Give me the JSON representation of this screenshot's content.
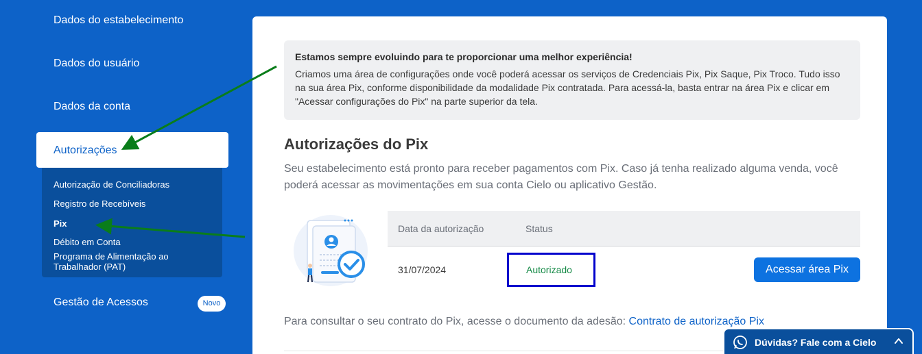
{
  "sidebar": {
    "items": [
      {
        "label": "Dados do estabelecimento"
      },
      {
        "label": "Dados do usuário"
      },
      {
        "label": "Dados da conta"
      }
    ],
    "active": {
      "label": "Autorizações"
    },
    "subitems": [
      {
        "label": "Autorização de Conciliadoras"
      },
      {
        "label": "Registro de Recebíveis"
      },
      {
        "label": "Pix"
      },
      {
        "label": "Débito em Conta"
      },
      {
        "label": "Programa de Alimentação ao Trabalhador (PAT)"
      }
    ],
    "gestao": {
      "label": "Gestão de Acessos",
      "badge": "Novo"
    }
  },
  "info_box": {
    "title": "Estamos sempre evoluindo para te proporcionar uma melhor experiência!",
    "body": "Criamos uma área de configurações onde você poderá acessar os serviços de Credenciais Pix, Pix Saque, Pix Troco. Tudo isso na sua área Pix, conforme disponibilidade da modalidade Pix contratada. Para acessá-la, basta entrar na área Pix e clicar em \"Acessar configurações do Pix\" na parte superior da tela."
  },
  "section": {
    "title": "Autorizações do Pix",
    "description": "Seu estabelecimento está pronto para receber pagamentos com Pix. Caso já tenha realizado alguma venda, você poderá acessar as movimentações em sua conta Cielo ou aplicativo Gestão."
  },
  "table": {
    "headers": [
      "Data da autorização",
      "Status"
    ],
    "rows": [
      {
        "date": "31/07/2024",
        "status": "Autorizado",
        "action": "Acessar área Pix"
      }
    ]
  },
  "contract": {
    "text": "Para consultar o seu contrato do Pix, acesse o documento da adesão: ",
    "link": "Contrato de autorização Pix"
  },
  "chat": {
    "label": "Dúvidas? Fale com a Cielo",
    "icon": "whatsapp-icon"
  },
  "colors": {
    "brand_blue": "#0d62c8",
    "sidebar_sub": "#0a4f9c",
    "button_blue": "#0d72e0",
    "status_green": "#168a47",
    "annotation_arrow": "#0a7d1a",
    "highlight_box": "#0000cc"
  }
}
